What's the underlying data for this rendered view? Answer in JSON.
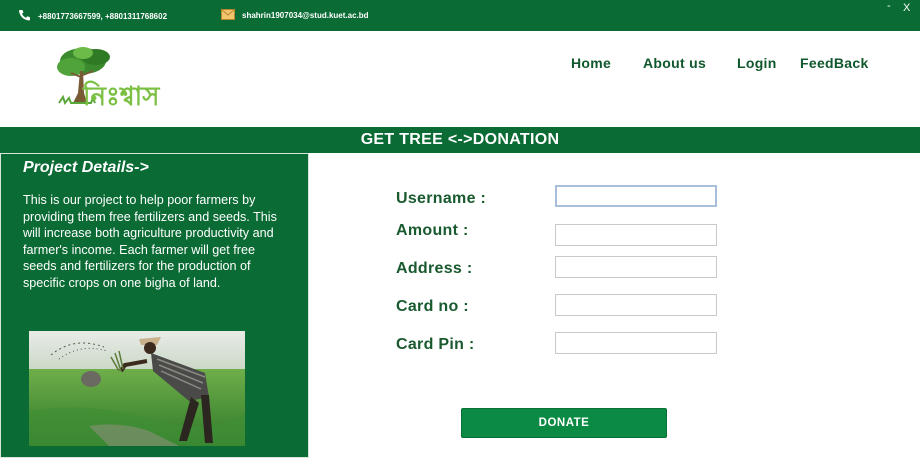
{
  "topbar": {
    "phones": "+8801773667599, +8801311768602",
    "email": "shahrin1907034@stud.kuet.ac.bd",
    "minimize": "-",
    "close": "X"
  },
  "header": {
    "logo_text": "নিঃশ্বাস",
    "nav": {
      "home": "Home",
      "about": "About us",
      "login": "Login",
      "feedback": "FeedBack"
    }
  },
  "band": {
    "title": "GET TREE <->DONATION"
  },
  "project": {
    "title": "Project Details->",
    "body": "This is our project to help poor farmers by providing them free fertilizers and seeds. This will increase both agriculture productivity and farmer's income. Each farmer will get free seeds and fertilizers for the production of specific crops on one bigha of land."
  },
  "form": {
    "username_label": "Username :",
    "amount_label": "Amount :",
    "address_label": "Address :",
    "cardno_label": "Card no :",
    "cardpin_label": "Card Pin :",
    "username_value": "",
    "amount_value": "",
    "address_value": "",
    "cardno_value": "",
    "cardpin_value": "",
    "donate_label": "DONATE"
  },
  "colors": {
    "primary_green": "#0a6b34",
    "button_green": "#0b8a43",
    "label_green": "#1a5a2f"
  },
  "icons": {
    "phone": "phone-icon",
    "email": "envelope-icon"
  }
}
